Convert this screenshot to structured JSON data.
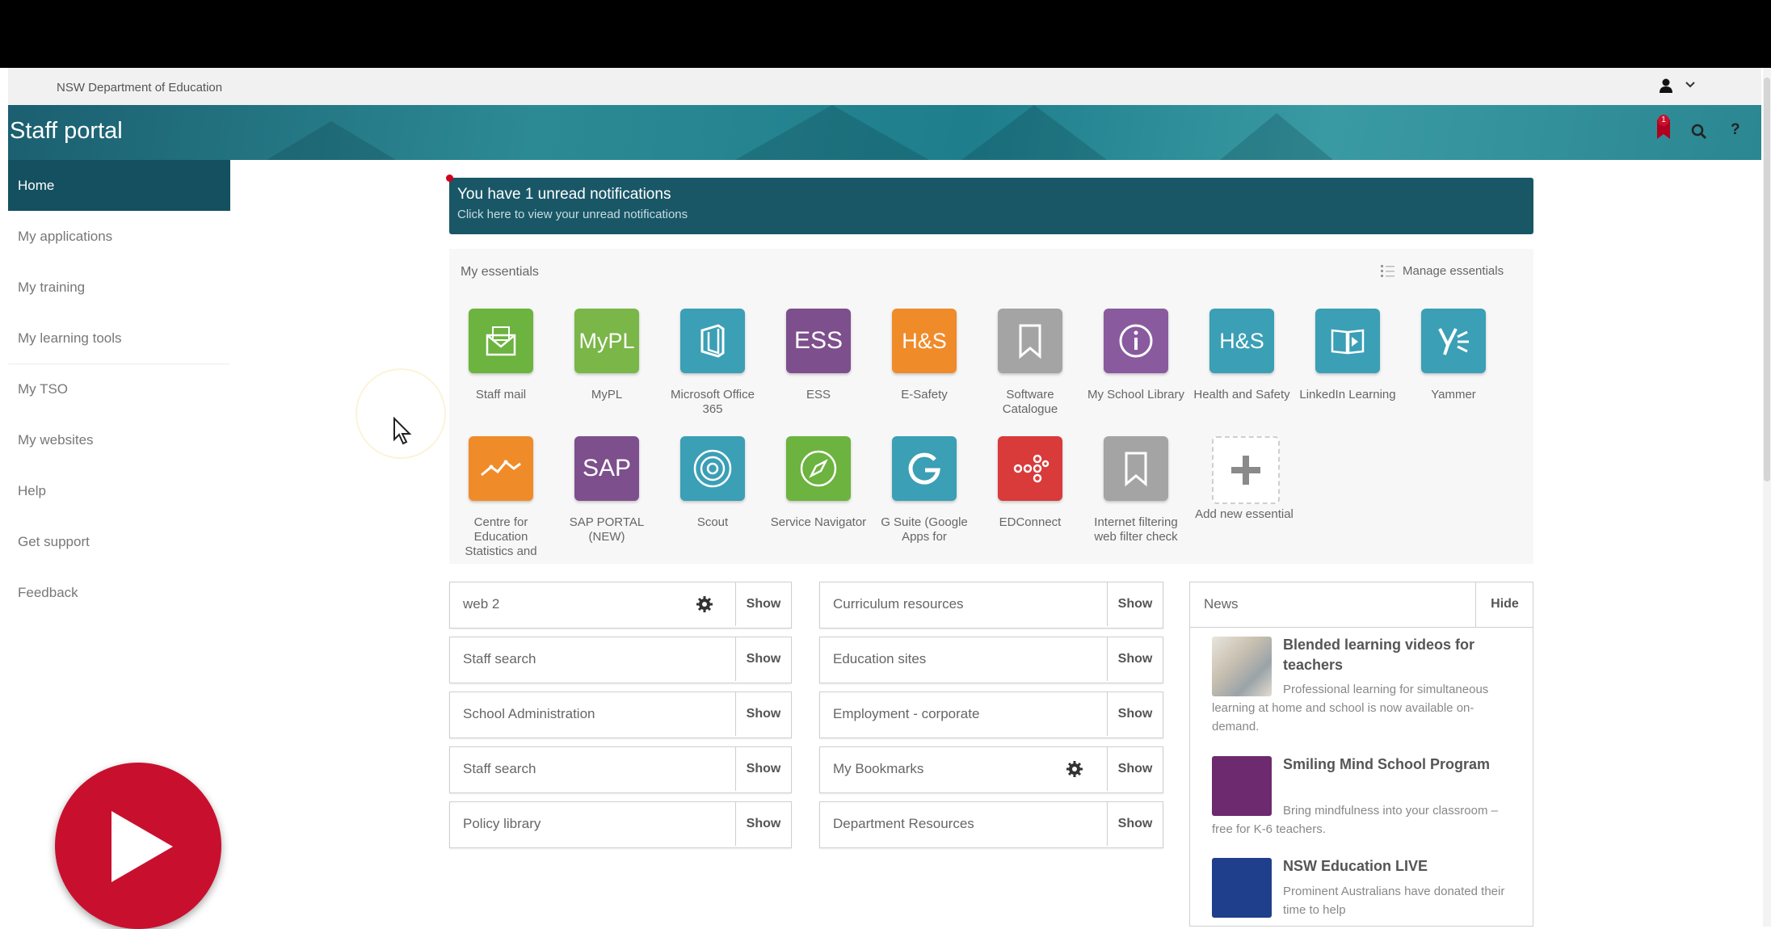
{
  "dept_bar": {
    "name": "NSW Department of Education",
    "user_icon": "person-icon",
    "user_caret": "⌄"
  },
  "header": {
    "title": "Staff portal",
    "notification_count": "1",
    "help": "?"
  },
  "sidebar": {
    "items": [
      {
        "label": "Home",
        "active": true
      },
      {
        "label": "My applications"
      },
      {
        "label": "My training"
      },
      {
        "label": "My learning tools"
      },
      {
        "label": "My TSO"
      },
      {
        "label": "My websites"
      },
      {
        "label": "Help"
      },
      {
        "label": "Get support"
      },
      {
        "label": "Feedback"
      }
    ]
  },
  "notification_banner": {
    "title": "You have 1 unread notifications",
    "subtitle": "Click here to view your unread notifications"
  },
  "essentials": {
    "title": "My essentials",
    "manage_label": "Manage essentials",
    "tiles": [
      {
        "label": "Staff mail",
        "icon": "mail-icon",
        "color": "#6cb33f",
        "text": ""
      },
      {
        "label": "MyPL",
        "icon": "mypl-logo",
        "color": "#7ab648",
        "text": "MyPL"
      },
      {
        "label": "Microsoft Office 365",
        "icon": "office-icon",
        "color": "#3b9fb5",
        "text": ""
      },
      {
        "label": "ESS",
        "icon": "ess-logo",
        "color": "#7d4f8c",
        "text": "ESS"
      },
      {
        "label": "E-Safety",
        "icon": "hs-logo",
        "color": "#f08b2a",
        "text": "H&S"
      },
      {
        "label": "Software Catalogue",
        "icon": "bookmark-icon",
        "color": "#a4a4a4",
        "text": ""
      },
      {
        "label": "My School Library",
        "icon": "info-icon",
        "color": "#8a5a9e",
        "text": ""
      },
      {
        "label": "Health and Safety",
        "icon": "hs-logo",
        "color": "#3b9fb5",
        "text": "H&S"
      },
      {
        "label": "LinkedIn Learning",
        "icon": "video-book-icon",
        "color": "#3b9fb5",
        "text": ""
      },
      {
        "label": "Yammer",
        "icon": "yammer-icon",
        "color": "#3b9fb5",
        "text": ""
      },
      {
        "label": "Centre for Education Statistics and",
        "icon": "chart-line-icon",
        "color": "#f08b2a",
        "text": ""
      },
      {
        "label": "SAP PORTAL (NEW)",
        "icon": "sap-logo",
        "color": "#7d4f8c",
        "text": "SAP"
      },
      {
        "label": "Scout",
        "icon": "target-icon",
        "color": "#3b9fb5",
        "text": ""
      },
      {
        "label": "Service Navigator",
        "icon": "compass-icon",
        "color": "#6cb33f",
        "text": ""
      },
      {
        "label": "G Suite (Google Apps for",
        "icon": "google-icon",
        "color": "#3b9fb5",
        "text": ""
      },
      {
        "label": "EDConnect",
        "icon": "dots-icon",
        "color": "#d93a3a",
        "text": ""
      },
      {
        "label": "Internet filtering web filter check",
        "icon": "bookmark-icon",
        "color": "#a4a4a4",
        "text": ""
      },
      {
        "label": "Add new essential",
        "icon": "plus-icon",
        "color": "#ffffff",
        "text": "+"
      }
    ]
  },
  "panels": {
    "col1": [
      {
        "label": "web 2",
        "button": "Show",
        "gear": true
      },
      {
        "label": "Staff search",
        "button": "Show"
      },
      {
        "label": "School Administration",
        "button": "Show"
      },
      {
        "label": "Staff search",
        "button": "Show"
      },
      {
        "label": "Policy library",
        "button": "Show"
      }
    ],
    "col2": [
      {
        "label": "Curriculum resources",
        "button": "Show"
      },
      {
        "label": "Education sites",
        "button": "Show"
      },
      {
        "label": "Employment - corporate",
        "button": "Show"
      },
      {
        "label": "My Bookmarks",
        "button": "Show",
        "gear": true
      },
      {
        "label": "Department Resources",
        "button": "Show"
      }
    ]
  },
  "news": {
    "title": "News",
    "hide": "Hide",
    "items": [
      {
        "title": "Blended learning videos for teachers",
        "body": "Professional learning for simultaneous learning at home and school is now available on-demand."
      },
      {
        "title": "Smiling Mind School Program",
        "body": "Bring mindfulness into your classroom – free for K-6 teachers."
      },
      {
        "title": "NSW Education LIVE",
        "body": "Prominent Australians have donated their time to help"
      }
    ]
  },
  "video": {
    "play_icon": "play-icon"
  }
}
